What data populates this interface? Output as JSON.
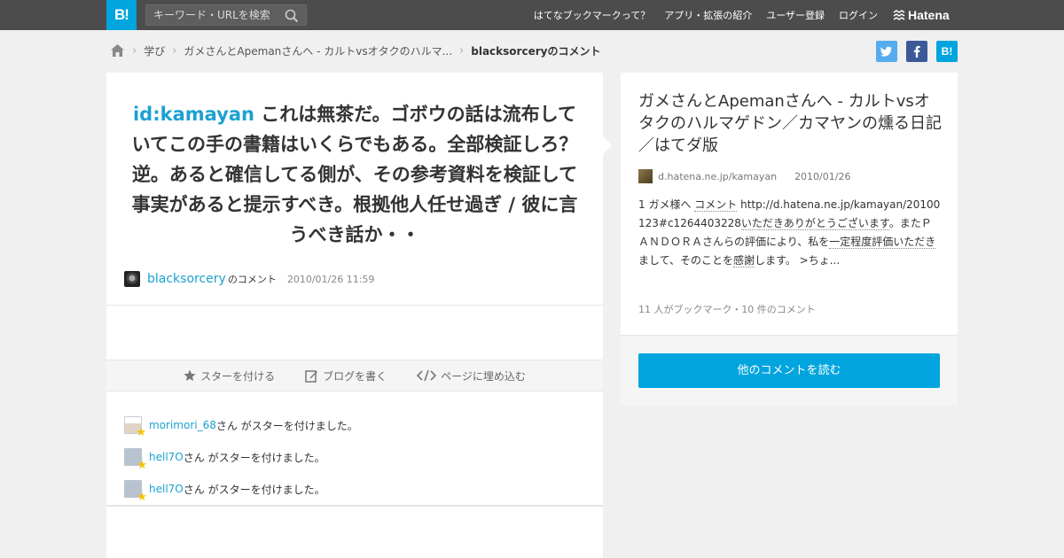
{
  "header": {
    "logo": "B!",
    "search_placeholder": "キーワード・URLを検索",
    "nav": [
      "はてなブックマークって？",
      "アプリ・拡張の紹介",
      "ユーザー登録",
      "ログイン"
    ],
    "brand": "Hatena"
  },
  "breadcrumb": {
    "items": [
      "学び",
      "ガメさんとApemanさんへ - カルトvsオタクのハルマ..."
    ],
    "current": "blacksorceryのコメント"
  },
  "share": {
    "hatena": "B!"
  },
  "comment": {
    "user_id": "id:kamayan",
    "text": " これは無茶だ。ゴボウの話は流布していてこの手の書籍はいくらでもある。全部検証しろ？逆。あると確信してる側が、その参考資料を検証して事実があると提示すべき。根拠他人任せ過ぎ / 彼に言うべき話か・・",
    "author": "blacksorcery",
    "author_suffix": "のコメント",
    "date": "2010/01/26 11:59"
  },
  "actions": {
    "star": "スターを付ける",
    "blog": "ブログを書く",
    "embed": "ページに埋め込む"
  },
  "stars": [
    {
      "name": "morimori_68",
      "text": "さん がスターを付けました。"
    },
    {
      "name": "hell7O",
      "text": "さん がスターを付けました。"
    },
    {
      "name": "hell7O",
      "text": "さん がスターを付けました。"
    }
  ],
  "entry": {
    "title": "ガメさんとApemanさんへ - カルトvsオタクのハルマゲドン／カマヤンの燻る日記／はてダ版",
    "domain": "d.hatena.ne.jp/kamayan",
    "date": "2010/01/26",
    "excerpt_1": "1 ガメ様へ ",
    "excerpt_link1": "コメント",
    "excerpt_2": " http://d.hatena.ne.jp/kamayan/20100123#c1264403228",
    "excerpt_link2": "いただきありがとうございます",
    "excerpt_3": "。またＰＡＮＤＯＲＡさんらの評価により、私を",
    "excerpt_link3": "一定程度評価いただき",
    "excerpt_4": "まして、そのことを",
    "excerpt_link4": "感謝",
    "excerpt_5": "します。 >ちょ...",
    "counts": "11 人がブックマーク・10 件のコメント",
    "more_button": "他のコメントを読む"
  },
  "colors": {
    "accent": "#00a4de",
    "link": "#1ba1d1",
    "topbar": "#4c4c4c"
  }
}
